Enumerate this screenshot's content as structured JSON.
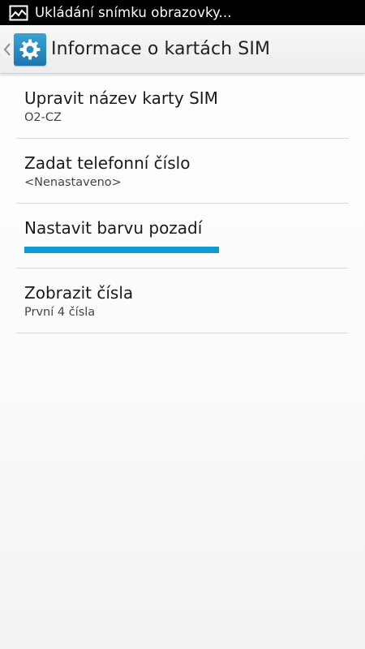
{
  "status_bar": {
    "text": "Ukládání snímku obrazovky...",
    "icon": "screenshot-icon"
  },
  "action_bar": {
    "back_icon": "chevron-left-icon",
    "app_icon": "gear-icon",
    "title": "Informace o kartách SIM"
  },
  "items": [
    {
      "title": "Upravit název karty SIM",
      "summary": "O2-CZ"
    },
    {
      "title": "Zadat telefonní číslo",
      "summary": "<Nenastaveno>"
    },
    {
      "title": "Nastavit barvu pozadí",
      "color": "#0f9bd7"
    },
    {
      "title": "Zobrazit čísla",
      "summary": "První 4 čísla"
    }
  ]
}
